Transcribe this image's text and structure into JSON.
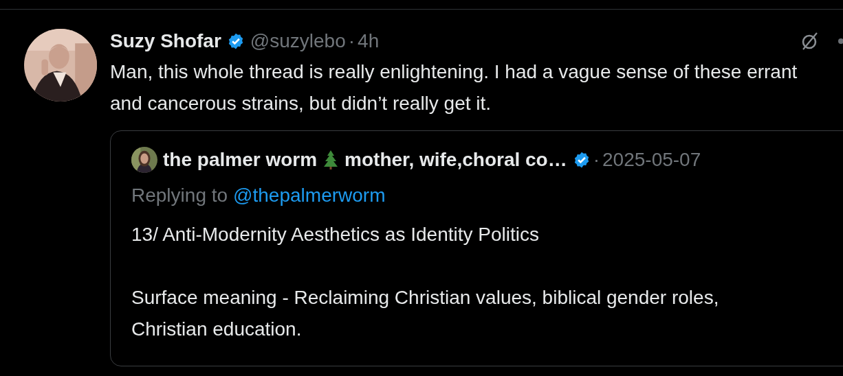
{
  "tweet": {
    "author": {
      "name": "Suzy Shofar",
      "verified": true,
      "handle": "@suzylebo",
      "separator": "·",
      "time": "4h"
    },
    "text": "Man, this whole thread is really enlightening. I had a vague sense of these errant and cancerous strains, but didn’t really get it.",
    "quoted_tweet": {
      "author": {
        "name": "the palmer worm",
        "name_rest": "mother, wife,choral co…",
        "verified": true,
        "separator": "·",
        "date": "2025-05-07"
      },
      "replying_label": "Replying to",
      "replying_handle": "@thepalmerworm",
      "paragraphs": [
        "13/ Anti-Modernity Aesthetics as Identity Politics",
        "Surface meaning - Reclaiming Christian values, biblical gender roles, Christian education."
      ]
    }
  }
}
